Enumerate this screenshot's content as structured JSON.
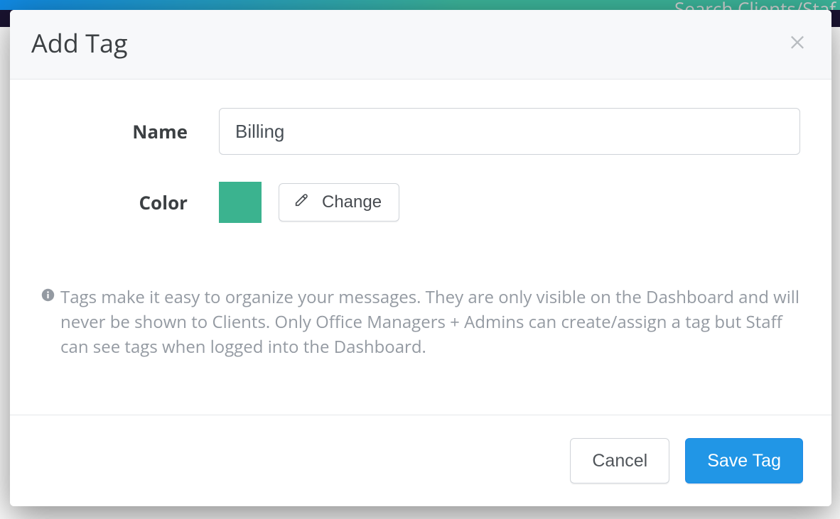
{
  "backdrop": {
    "search_placeholder": "Search Clients/Staf"
  },
  "modal": {
    "title": "Add Tag",
    "name_label": "Name",
    "name_value": "Billing",
    "color_label": "Color",
    "color_hex": "#3bb38f",
    "change_label": "Change",
    "info_text": "Tags make it easy to organize your messages. They are only visible on the Dashboard and will never be shown to Clients. Only Office Managers + Admins can create/assign a tag but Staff can see tags when logged into the Dashboard.",
    "cancel_label": "Cancel",
    "save_label": "Save Tag"
  }
}
